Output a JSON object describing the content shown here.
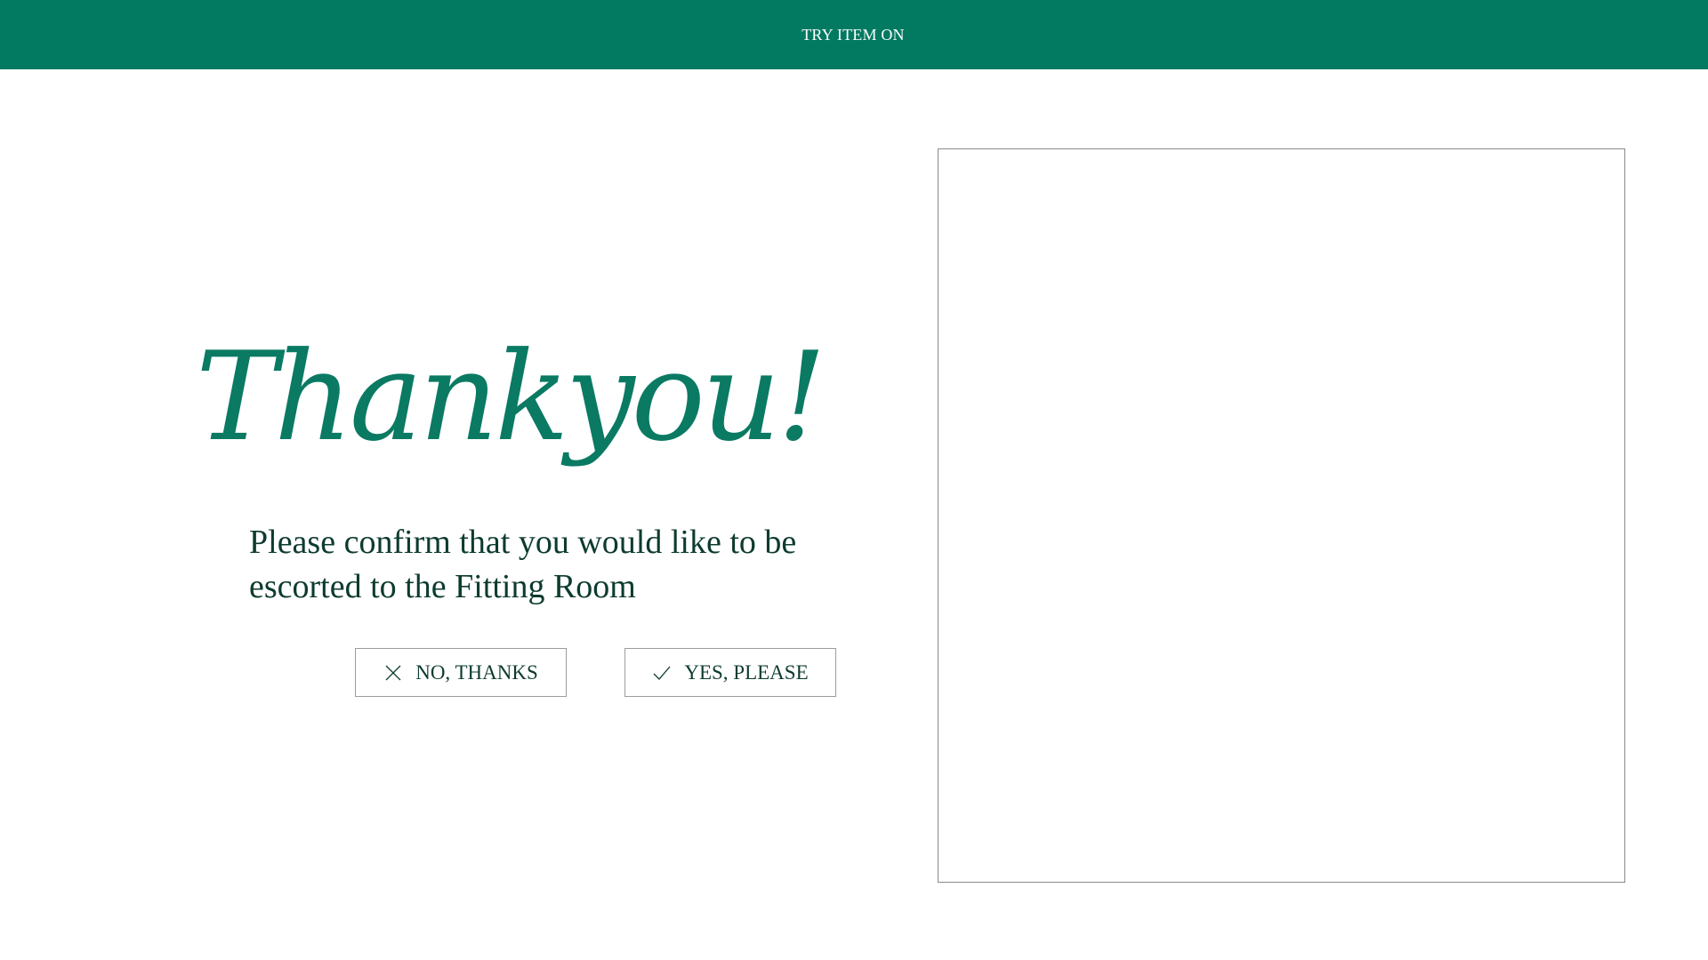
{
  "header": {
    "title": "TRY ITEM ON",
    "background_color": "#027a62"
  },
  "main": {
    "heading": "Thankyou!",
    "message": "Please confirm that you would like to be escorted to the Fitting Room",
    "accent_color": "#0a7a63"
  },
  "actions": {
    "no_label": "NO, THANKS",
    "no_icon": "close-icon",
    "yes_label": "YES, PLEASE",
    "yes_icon": "checkmark-icon"
  }
}
